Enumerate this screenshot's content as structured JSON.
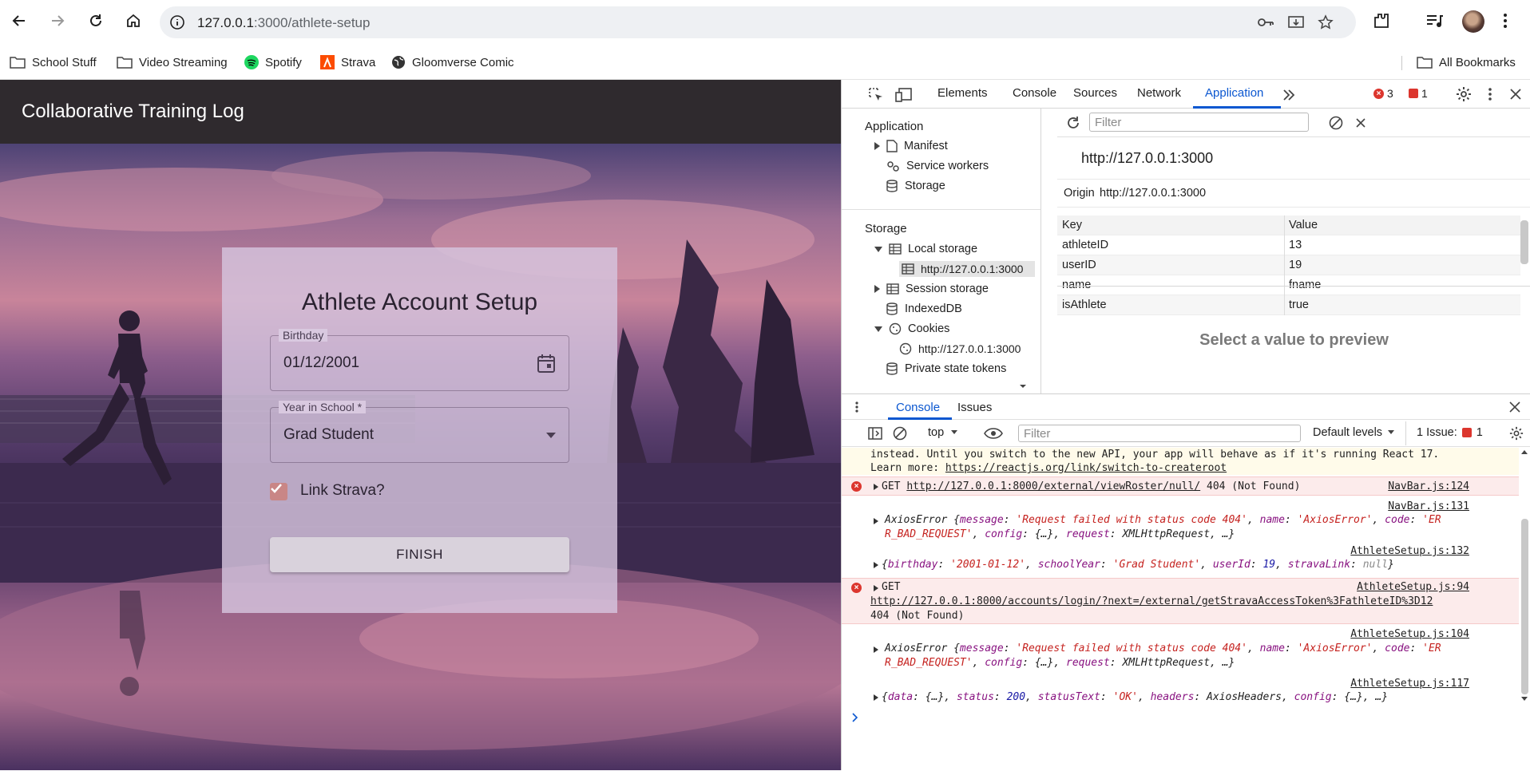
{
  "browser": {
    "url_host": "127.0.0.1",
    "url_rest": ":3000/athlete-setup",
    "bookmarks": [
      "School Stuff",
      "Video Streaming",
      "Spotify",
      "Strava",
      "Gloomverse Comic"
    ],
    "all_bookmarks": "All Bookmarks"
  },
  "app": {
    "title": "Collaborative Training Log",
    "card_title": "Athlete Account Setup",
    "birthday_label": "Birthday",
    "birthday_value": "01/12/2001",
    "year_label": "Year in School *",
    "year_value": "Grad Student",
    "link_strava_label": "Link Strava?",
    "link_strava_checked": true,
    "finish_label": "FINISH"
  },
  "devtools": {
    "tabs": [
      "Elements",
      "Console",
      "Sources",
      "Network",
      "Application"
    ],
    "active_tab": "Application",
    "error_count": "3",
    "issue_count": "1",
    "sidebar": {
      "application_header": "Application",
      "application_items": [
        "Manifest",
        "Service workers",
        "Storage"
      ],
      "storage_header": "Storage",
      "local_storage": "Local storage",
      "local_storage_origin": "http://127.0.0.1:3000",
      "session_storage": "Session storage",
      "indexeddb": "IndexedDB",
      "cookies": "Cookies",
      "cookies_origin": "http://127.0.0.1:3000",
      "private_state_tokens": "Private state tokens"
    },
    "storage": {
      "filter_placeholder": "Filter",
      "origin_title": "http://127.0.0.1:3000",
      "origin_label": "Origin",
      "origin_value": "http://127.0.0.1:3000",
      "columns": [
        "Key",
        "Value"
      ],
      "rows": [
        {
          "key": "athleteID",
          "value": "13"
        },
        {
          "key": "userID",
          "value": "19"
        },
        {
          "key": "name",
          "value": "fname"
        },
        {
          "key": "isAthlete",
          "value": "true"
        }
      ],
      "preview_text": "Select a value to preview"
    },
    "drawer": {
      "tabs": [
        "Console",
        "Issues"
      ],
      "context": "top",
      "filter_placeholder": "Filter",
      "levels": "Default levels",
      "issues_label": "1 Issue:",
      "issues_count": "1"
    },
    "console": {
      "line1": "instead. Until you switch to the new API, your app will behave as if it's running React 17.",
      "line2_prefix": "Learn more: ",
      "line2_link": "https://reactjs.org/link/switch-to-createroot",
      "err1_method": "GET",
      "err1_url": "http://127.0.0.1:8000/external/viewRoster/null/",
      "err1_status": "404 (Not Found)",
      "err1_src": "NavBar.js:124",
      "log1_src": "NavBar.js:131",
      "log2_src": "AthleteSetup.js:132",
      "err2_method": "GET",
      "err2_src": "AthleteSetup.js:94",
      "err2_url": "http://127.0.0.1:8000/accounts/login/?next=/external/getStravaAccessToken%3FathleteID%3D12",
      "err2_status": "404 (Not Found)",
      "log3_src": "AthleteSetup.js:104",
      "log4_src": "AthleteSetup.js:117"
    }
  }
}
